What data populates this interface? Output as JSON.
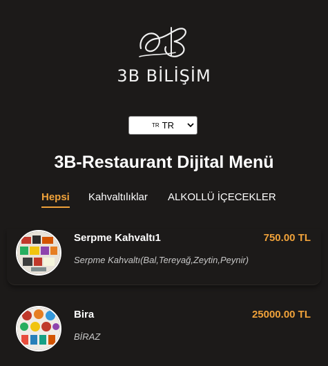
{
  "brand": {
    "name": "3B BİLİŞİM"
  },
  "language": {
    "flag": "TR",
    "selected": "TR"
  },
  "menu": {
    "title": "3B-Restaurant Dijital Menü"
  },
  "tabs": [
    {
      "label": "Hepsi",
      "active": true
    },
    {
      "label": "Kahvaltılıklar",
      "active": false
    },
    {
      "label": "ALKOLLÜ İÇECEKLER",
      "active": false
    }
  ],
  "items": [
    {
      "name": "Serpme Kahvaltı1",
      "price": "750.00 TL",
      "description": "Serpme Kahvaltı(Bal,Tereyağ,Zeytin,Peynir)"
    },
    {
      "name": "Bira",
      "price": "25000.00 TL",
      "description": "BİRAZ"
    }
  ],
  "colors": {
    "background": "#1c1a19",
    "accent": "#f0a23a",
    "text": "#ffffff"
  }
}
